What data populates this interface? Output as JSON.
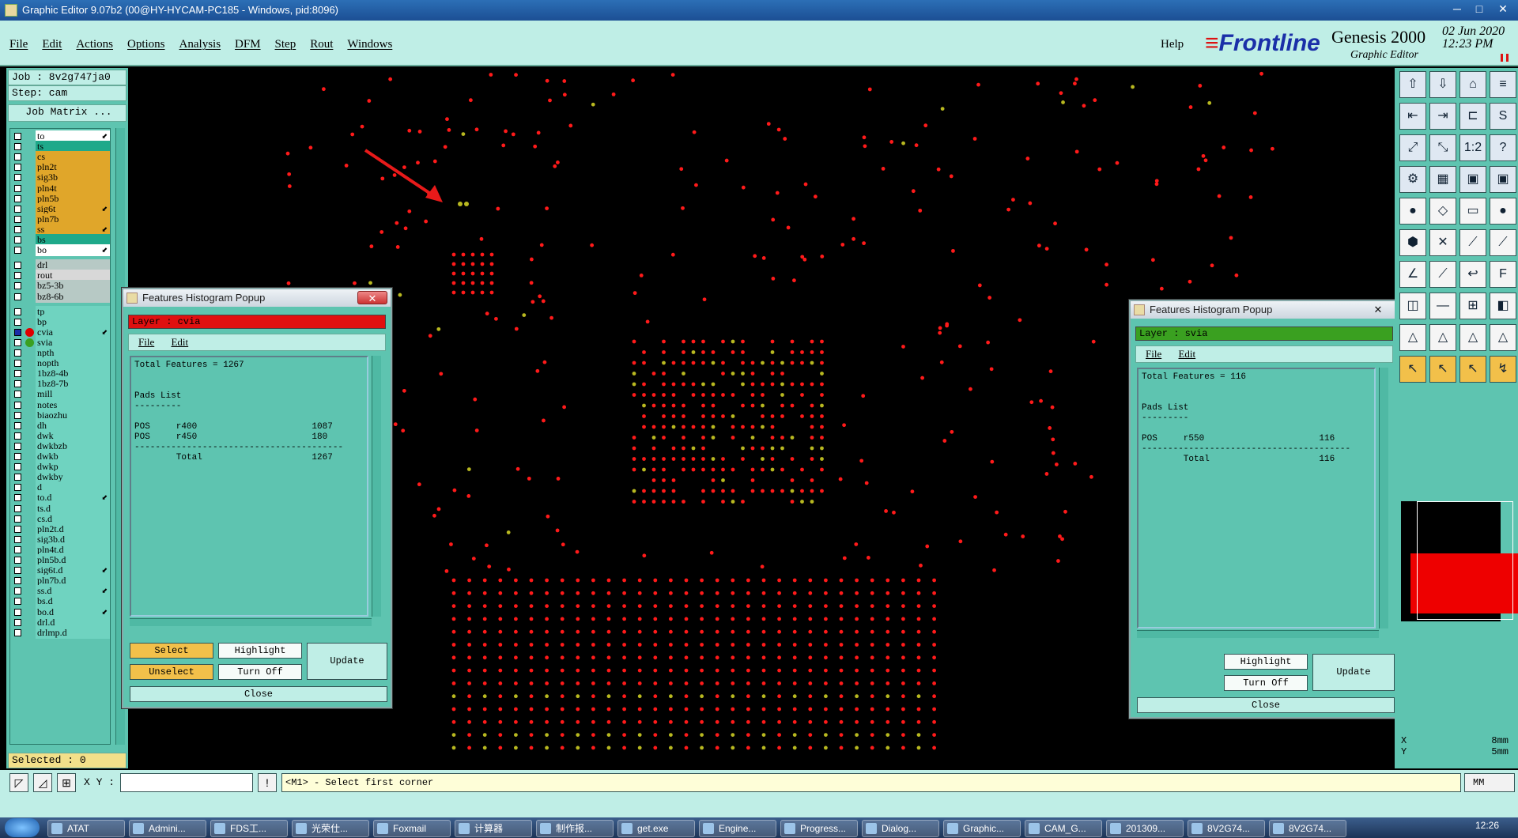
{
  "window": {
    "title": "Graphic Editor 9.07b2 (00@HY-HYCAM-PC185 - Windows, pid:8096)",
    "min": "─",
    "max": "□",
    "close": "✕"
  },
  "menu": {
    "items": [
      "File",
      "Edit",
      "Actions",
      "Options",
      "Analysis",
      "DFM",
      "Step",
      "Rout",
      "Windows"
    ],
    "help": "Help"
  },
  "brand": {
    "logo": "Frontline",
    "product": "Genesis 2000",
    "subtitle": "Graphic Editor",
    "date": "02 Jun 2020",
    "time": "12:23 PM"
  },
  "left": {
    "job": "Job : 8v2g747ja0",
    "step": "Step: cam",
    "job_matrix": "Job Matrix ...",
    "selected": "Selected : 0",
    "layers": [
      {
        "name": "to",
        "bg": "#ffffff",
        "arrow": true
      },
      {
        "name": "ts",
        "bg": "#1fa98a"
      },
      {
        "name": "cs",
        "bg": "#e0a62a"
      },
      {
        "name": "pln2t",
        "bg": "#e0a62a"
      },
      {
        "name": "sig3b",
        "bg": "#e0a62a"
      },
      {
        "name": "pln4t",
        "bg": "#e0a62a"
      },
      {
        "name": "pln5b",
        "bg": "#e0a62a"
      },
      {
        "name": "sig6t",
        "bg": "#e0a62a",
        "arrow": true
      },
      {
        "name": "pln7b",
        "bg": "#e0a62a"
      },
      {
        "name": "ss",
        "bg": "#e0a62a",
        "arrow": true
      },
      {
        "name": "bs",
        "bg": "#1fa98a"
      },
      {
        "name": "bo",
        "bg": "#ffffff",
        "arrow": true
      },
      {
        "name": "drl",
        "bg": "#b7c9c5"
      },
      {
        "name": "rout",
        "bg": "#d8d8d8"
      },
      {
        "name": "bz5-3b",
        "bg": "#b7c9c5"
      },
      {
        "name": "bz8-6b",
        "bg": "#b7c9c5"
      },
      {
        "name": "tp",
        "bg": "#6fd3c0"
      },
      {
        "name": "bp",
        "bg": "#6fd3c0"
      },
      {
        "name": "cvia",
        "bg": "#6fd3c0",
        "dot": "#e00000",
        "sel": true,
        "arrow": true
      },
      {
        "name": "svia",
        "bg": "#6fd3c0",
        "dot": "#3aa020"
      },
      {
        "name": "npth",
        "bg": "#6fd3c0"
      },
      {
        "name": "nopth",
        "bg": "#6fd3c0"
      },
      {
        "name": "1bz8-4b",
        "bg": "#6fd3c0"
      },
      {
        "name": "1bz8-7b",
        "bg": "#6fd3c0"
      },
      {
        "name": "mill",
        "bg": "#6fd3c0"
      },
      {
        "name": "notes",
        "bg": "#6fd3c0"
      },
      {
        "name": "biaozhu",
        "bg": "#6fd3c0"
      },
      {
        "name": "dh",
        "bg": "#6fd3c0"
      },
      {
        "name": "dwk",
        "bg": "#6fd3c0"
      },
      {
        "name": "dwkbzb",
        "bg": "#6fd3c0"
      },
      {
        "name": "dwkb",
        "bg": "#6fd3c0"
      },
      {
        "name": "dwkp",
        "bg": "#6fd3c0"
      },
      {
        "name": "dwkby",
        "bg": "#6fd3c0"
      },
      {
        "name": "d",
        "bg": "#6fd3c0"
      },
      {
        "name": "to.d",
        "bg": "#6fd3c0",
        "arrow": true
      },
      {
        "name": "ts.d",
        "bg": "#6fd3c0"
      },
      {
        "name": "cs.d",
        "bg": "#6fd3c0"
      },
      {
        "name": "pln2t.d",
        "bg": "#6fd3c0"
      },
      {
        "name": "sig3b.d",
        "bg": "#6fd3c0"
      },
      {
        "name": "pln4t.d",
        "bg": "#6fd3c0"
      },
      {
        "name": "pln5b.d",
        "bg": "#6fd3c0"
      },
      {
        "name": "sig6t.d",
        "bg": "#6fd3c0",
        "arrow": true
      },
      {
        "name": "pln7b.d",
        "bg": "#6fd3c0"
      },
      {
        "name": "ss.d",
        "bg": "#6fd3c0",
        "arrow": true
      },
      {
        "name": "bs.d",
        "bg": "#6fd3c0"
      },
      {
        "name": "bo.d",
        "bg": "#6fd3c0",
        "arrow": true
      },
      {
        "name": "drl.d",
        "bg": "#6fd3c0"
      },
      {
        "name": "drlmp.d",
        "bg": "#6fd3c0"
      }
    ]
  },
  "popup_left": {
    "title": "Features Histogram Popup",
    "close": "✕",
    "layer": "Layer :  cvia",
    "layer_color": "#e01010",
    "menu_file": "File",
    "menu_edit": "Edit",
    "text": "Total Features = 1267\n\n\nPads List\n---------\n\nPOS     r400                      1087\nPOS     r450                      180\n----------------------------------------\n        Total                     1267",
    "select": "Select",
    "highlight": "Highlight",
    "unselect": "Unselect",
    "turn_off": "Turn Off",
    "update": "Update",
    "close_btn": "Close"
  },
  "popup_right": {
    "title": "Features Histogram Popup",
    "close": "✕",
    "layer": "Layer :  svia",
    "layer_color": "#3aa020",
    "menu_file": "File",
    "menu_edit": "Edit",
    "text": "Total Features = 116\n\n\nPads List\n---------\n\nPOS     r550                      116\n----------------------------------------\n        Total                     116",
    "highlight": "Highlight",
    "turn_off": "Turn Off",
    "update": "Update",
    "close_btn": "Close"
  },
  "bottom": {
    "xy_label": "X Y :",
    "xy_value": "",
    "prompt": "<M1> - Select first corner",
    "unit": "MM"
  },
  "coords": {
    "x": "X",
    "y": "Y",
    "x_unit": "8mm",
    "y_unit": "5mm"
  },
  "taskbar": {
    "items": [
      "ATAT",
      "Admini...",
      "FDS工...",
      "光荣仕...",
      "Foxmail",
      "计算器",
      "制作报...",
      "get.exe",
      "Engine...",
      "Progress...",
      "Dialog...",
      "Graphic...",
      "CAM_G...",
      "201309...",
      "8V2G74...",
      "8V2G74..."
    ],
    "clock": "12:26"
  },
  "colors": {
    "panel": "#5ec4b0",
    "light_panel": "#bfeee6",
    "pad_red": "#ff1a1a",
    "pad_yellow": "#b8b820",
    "arrow": "#e81a1a"
  }
}
